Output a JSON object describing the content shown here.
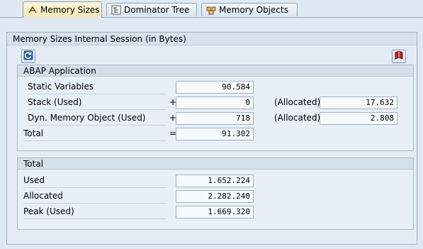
{
  "tabs": [
    {
      "label": "Memory Sizes",
      "icon": "memory-sizes-icon",
      "active": true
    },
    {
      "label": "Dominator Tree",
      "icon": "dominator-tree-icon",
      "active": false
    },
    {
      "label": "Memory Objects",
      "icon": "memory-objects-icon",
      "active": false
    }
  ],
  "frame": {
    "title": "Memory Sizes Internal Session (in Bytes)"
  },
  "toolbar": {
    "refresh_icon": "refresh-icon",
    "info_icon": "info-book-icon"
  },
  "abap": {
    "title": "ABAP Application",
    "rows": [
      {
        "label": "Static Variables",
        "op": "",
        "value": "90.584",
        "alloc_label": "",
        "alloc_value": ""
      },
      {
        "label": "Stack (Used)",
        "op": "+",
        "value": "0",
        "alloc_label": "(Allocated)",
        "alloc_value": "17.632"
      },
      {
        "label": "Dyn. Memory Object (Used)",
        "op": "+",
        "value": "718",
        "alloc_label": "(Allocated)",
        "alloc_value": "2.808"
      },
      {
        "label": "Total",
        "op": "=",
        "value": "91.302",
        "alloc_label": "",
        "alloc_value": ""
      }
    ]
  },
  "total": {
    "title": "Total",
    "rows": [
      {
        "label": "Used",
        "value": "1.652.224"
      },
      {
        "label": "Allocated",
        "value": "2.282.240"
      },
      {
        "label": "Peak (Used)",
        "value": "1.669.320"
      }
    ]
  }
}
